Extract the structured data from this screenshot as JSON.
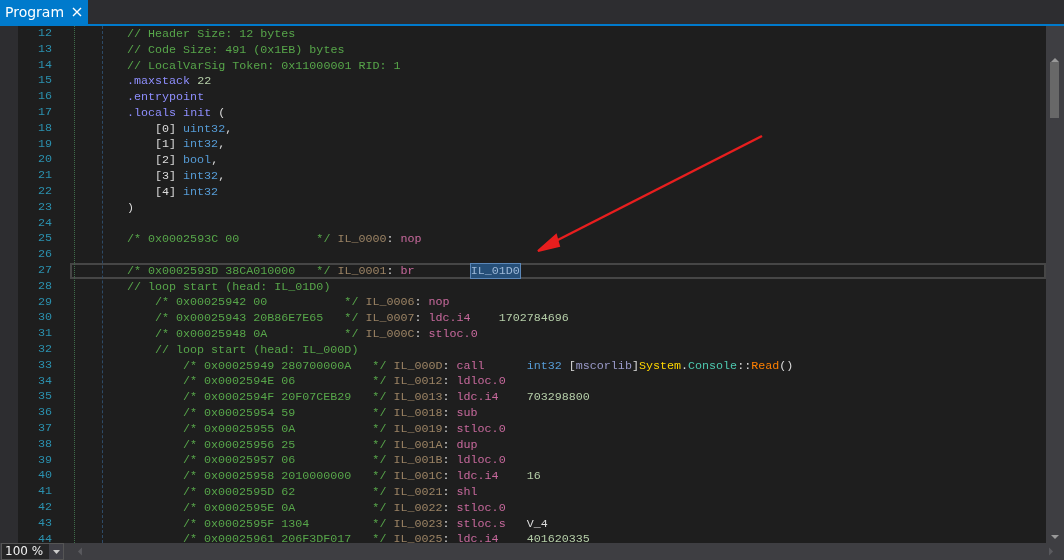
{
  "tab": {
    "label": "Program",
    "selected": true
  },
  "lines": [
    {
      "n": "12",
      "current": false,
      "tokens": [
        {
          "kind": "comment",
          "text": "// Header Size: 12 bytes"
        }
      ]
    },
    {
      "n": "13",
      "current": false,
      "tokens": [
        {
          "kind": "comment",
          "text": "// Code Size: 491 (0x1EB) bytes"
        }
      ]
    },
    {
      "n": "14",
      "current": false,
      "tokens": [
        {
          "kind": "comment",
          "text": "// LocalVarSig Token: 0x11000001 RID: 1"
        }
      ]
    },
    {
      "n": "15",
      "current": false,
      "tokens": [
        {
          "kind": "directive",
          "text": ".maxstack"
        },
        {
          "kind": "number",
          "text": " 22"
        }
      ]
    },
    {
      "n": "16",
      "current": false,
      "tokens": [
        {
          "kind": "directive",
          "text": ".entrypoint"
        }
      ]
    },
    {
      "n": "17",
      "current": false,
      "tokens": [
        {
          "kind": "directive",
          "text": ".locals"
        },
        {
          "kind": "directive",
          "text": " init"
        },
        {
          "kind": "punct",
          "text": " ("
        }
      ],
      "children": [
        {
          "n": "18",
          "current": false,
          "tokens": [
            {
              "kind": "punct",
              "text": "[0]"
            },
            {
              "kind": "type",
              "text": " uint32"
            },
            {
              "kind": "punct",
              "text": ","
            }
          ]
        },
        {
          "n": "19",
          "current": false,
          "tokens": [
            {
              "kind": "punct",
              "text": "[1]"
            },
            {
              "kind": "type",
              "text": " int32"
            },
            {
              "kind": "punct",
              "text": ","
            }
          ]
        },
        {
          "n": "20",
          "current": false,
          "tokens": [
            {
              "kind": "punct",
              "text": "[2]"
            },
            {
              "kind": "type",
              "text": " bool"
            },
            {
              "kind": "punct",
              "text": ","
            }
          ]
        },
        {
          "n": "21",
          "current": false,
          "tokens": [
            {
              "kind": "punct",
              "text": "[3]"
            },
            {
              "kind": "type",
              "text": " int32"
            },
            {
              "kind": "punct",
              "text": ","
            }
          ]
        },
        {
          "n": "22",
          "current": false,
          "tokens": [
            {
              "kind": "punct",
              "text": "[4]"
            },
            {
              "kind": "type",
              "text": " int32"
            }
          ]
        }
      ]
    },
    {
      "n": "23",
      "current": false,
      "tokens": [
        {
          "kind": "punct",
          "text": ")"
        }
      ]
    },
    {
      "n": "24",
      "current": false
    },
    {
      "n": "25",
      "current": false,
      "tokens": [
        {
          "kind": "comment",
          "text": "/* 0x0002593C 00           */"
        },
        {
          "kind": "label",
          "text": " IL_0000"
        },
        {
          "kind": "punct",
          "text": ":"
        },
        {
          "kind": "opcode",
          "text": " nop"
        }
      ]
    },
    {
      "n": "26",
      "current": false
    },
    {
      "n": "27",
      "current": true,
      "tokens": [
        {
          "kind": "comment",
          "text": "/* 0x0002593D 38CA010000   */"
        },
        {
          "kind": "label",
          "text": " IL_0001"
        },
        {
          "kind": "punct",
          "text": ":"
        },
        {
          "kind": "opcode",
          "text": " br"
        },
        {
          "kind": "highlight",
          "text": "IL_01D0"
        }
      ]
    },
    {
      "n": "28",
      "current": false,
      "tokens": [
        {
          "kind": "comment",
          "text": "// loop start (head: IL_01D0)"
        }
      ],
      "children": [
        {
          "n": "29",
          "current": false,
          "tokens": [
            {
              "kind": "comment",
              "text": "/* 0x00025942 00           */"
            },
            {
              "kind": "label",
              "text": " IL_0006"
            },
            {
              "kind": "punct",
              "text": ":"
            },
            {
              "kind": "opcode",
              "text": " nop"
            }
          ]
        },
        {
          "n": "30",
          "current": false,
          "tokens": [
            {
              "kind": "comment",
              "text": "/* 0x00025943 20B86E7E65   */"
            },
            {
              "kind": "label",
              "text": " IL_0007"
            },
            {
              "kind": "punct",
              "text": ":"
            },
            {
              "kind": "opcode",
              "text": " ldc.i4"
            },
            {
              "kind": "number",
              "text": "1702784696"
            }
          ]
        },
        {
          "n": "31",
          "current": false,
          "tokens": [
            {
              "kind": "comment",
              "text": "/* 0x00025948 0A           */"
            },
            {
              "kind": "label",
              "text": " IL_000C"
            },
            {
              "kind": "punct",
              "text": ":"
            },
            {
              "kind": "opcode",
              "text": " stloc.0"
            }
          ]
        },
        {
          "n": "32",
          "current": false,
          "tokens": [
            {
              "kind": "comment",
              "text": "// loop start (head: IL_000D)"
            }
          ],
          "children": [
            {
              "n": "33",
              "current": false,
              "tokens": [
                {
                  "kind": "comment",
                  "text": "/* 0x00025949 280700000A   */"
                },
                {
                  "kind": "label",
                  "text": " IL_000D"
                },
                {
                  "kind": "punct",
                  "text": ":"
                },
                {
                  "kind": "opcode",
                  "text": " call"
                },
                {
                  "kind": "type",
                  "text": "int32"
                },
                {
                  "kind": "punct",
                  "text": " ["
                },
                {
                  "kind": "assembly",
                  "text": "mscorlib"
                },
                {
                  "kind": "punct",
                  "text": "]"
                },
                {
                  "kind": "namespace",
                  "text": "System"
                },
                {
                  "kind": "punct",
                  "text": "."
                },
                {
                  "kind": "class",
                  "text": "Console"
                },
                {
                  "kind": "punct",
                  "text": "::"
                },
                {
                  "kind": "method",
                  "text": "Read"
                },
                {
                  "kind": "punct",
                  "text": "()"
                }
              ]
            },
            {
              "n": "34",
              "current": false,
              "tokens": [
                {
                  "kind": "comment",
                  "text": "/* 0x0002594E 06           */"
                },
                {
                  "kind": "label",
                  "text": " IL_0012"
                },
                {
                  "kind": "punct",
                  "text": ":"
                },
                {
                  "kind": "opcode",
                  "text": " ldloc.0"
                }
              ]
            },
            {
              "n": "35",
              "current": false,
              "tokens": [
                {
                  "kind": "comment",
                  "text": "/* 0x0002594F 20F07CEB29   */"
                },
                {
                  "kind": "label",
                  "text": " IL_0013"
                },
                {
                  "kind": "punct",
                  "text": ":"
                },
                {
                  "kind": "opcode",
                  "text": " ldc.i4"
                },
                {
                  "kind": "number",
                  "text": "703298800"
                }
              ]
            },
            {
              "n": "36",
              "current": false,
              "tokens": [
                {
                  "kind": "comment",
                  "text": "/* 0x00025954 59           */"
                },
                {
                  "kind": "label",
                  "text": " IL_0018"
                },
                {
                  "kind": "punct",
                  "text": ":"
                },
                {
                  "kind": "opcode",
                  "text": " sub"
                }
              ]
            },
            {
              "n": "37",
              "current": false,
              "tokens": [
                {
                  "kind": "comment",
                  "text": "/* 0x00025955 0A           */"
                },
                {
                  "kind": "label",
                  "text": " IL_0019"
                },
                {
                  "kind": "punct",
                  "text": ":"
                },
                {
                  "kind": "opcode",
                  "text": " stloc.0"
                }
              ]
            },
            {
              "n": "38",
              "current": false,
              "tokens": [
                {
                  "kind": "comment",
                  "text": "/* 0x00025956 25           */"
                },
                {
                  "kind": "label",
                  "text": " IL_001A"
                },
                {
                  "kind": "punct",
                  "text": ":"
                },
                {
                  "kind": "opcode",
                  "text": " dup"
                }
              ]
            },
            {
              "n": "39",
              "current": false,
              "tokens": [
                {
                  "kind": "comment",
                  "text": "/* 0x00025957 06           */"
                },
                {
                  "kind": "label",
                  "text": " IL_001B"
                },
                {
                  "kind": "punct",
                  "text": ":"
                },
                {
                  "kind": "opcode",
                  "text": " ldloc.0"
                }
              ]
            },
            {
              "n": "40",
              "current": false,
              "tokens": [
                {
                  "kind": "comment",
                  "text": "/* 0x00025958 2010000000   */"
                },
                {
                  "kind": "label",
                  "text": " IL_001C"
                },
                {
                  "kind": "punct",
                  "text": ":"
                },
                {
                  "kind": "opcode",
                  "text": " ldc.i4"
                },
                {
                  "kind": "number",
                  "text": "16"
                }
              ]
            },
            {
              "n": "41",
              "current": false,
              "tokens": [
                {
                  "kind": "comment",
                  "text": "/* 0x0002595D 62           */"
                },
                {
                  "kind": "label",
                  "text": " IL_0021"
                },
                {
                  "kind": "punct",
                  "text": ":"
                },
                {
                  "kind": "opcode",
                  "text": " shl"
                }
              ]
            },
            {
              "n": "42",
              "current": false,
              "tokens": [
                {
                  "kind": "comment",
                  "text": "/* 0x0002595E 0A           */"
                },
                {
                  "kind": "label",
                  "text": " IL_0022"
                },
                {
                  "kind": "punct",
                  "text": ":"
                },
                {
                  "kind": "opcode",
                  "text": " stloc.0"
                }
              ]
            },
            {
              "n": "43",
              "current": false,
              "tokens": [
                {
                  "kind": "comment",
                  "text": "/* 0x0002595F 1304         */"
                },
                {
                  "kind": "label",
                  "text": " IL_0023"
                },
                {
                  "kind": "punct",
                  "text": ":"
                },
                {
                  "kind": "opcode",
                  "text": " stloc.s"
                },
                {
                  "kind": "local",
                  "text": "V_4"
                }
              ]
            },
            {
              "n": "44",
              "current": false,
              "tokens": [
                {
                  "kind": "comment",
                  "text": "/* 0x00025961 206F3DF017   */"
                },
                {
                  "kind": "label",
                  "text": " IL_0025"
                },
                {
                  "kind": "punct",
                  "text": ":"
                },
                {
                  "kind": "opcode",
                  "text": " ldc.i4"
                },
                {
                  "kind": "number",
                  "text": "401620335"
                }
              ]
            }
          ]
        }
      ]
    }
  ],
  "status_bar": {
    "zoom": "100 %"
  }
}
